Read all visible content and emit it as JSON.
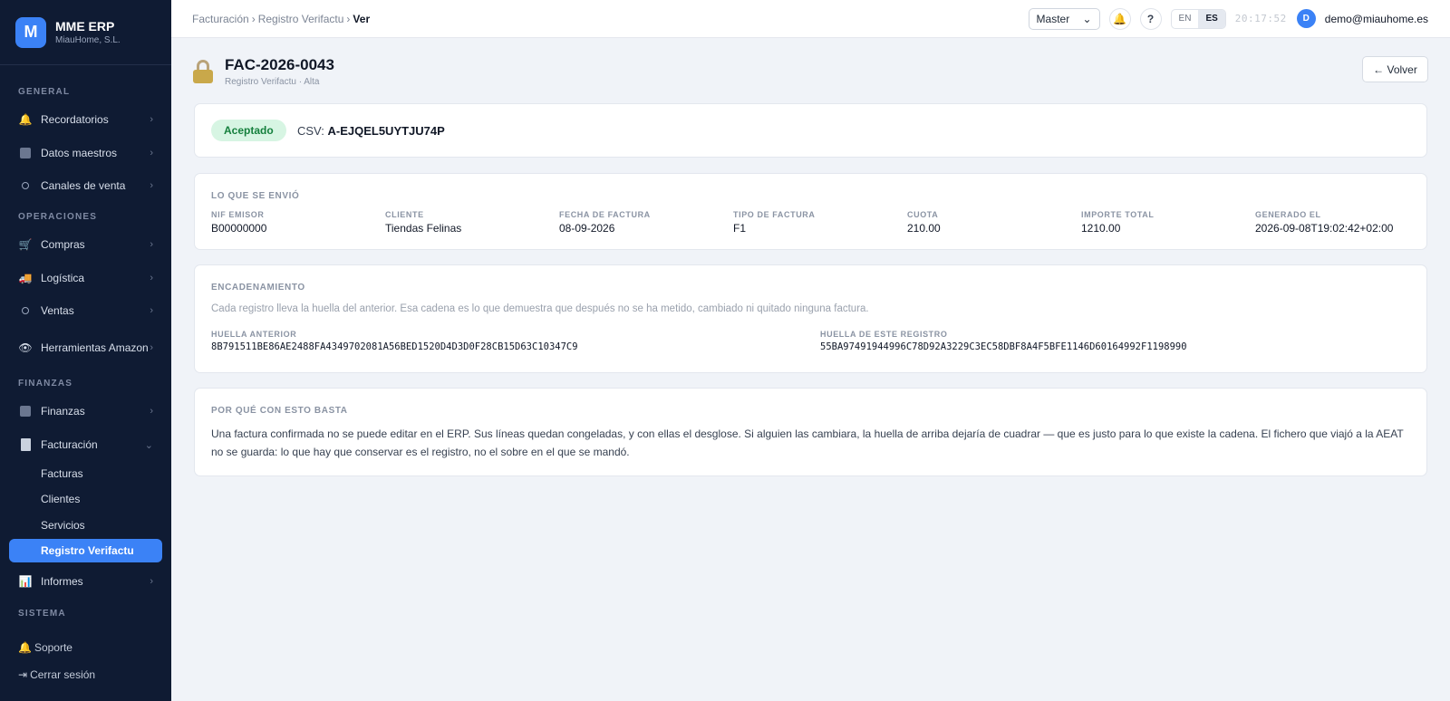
{
  "brand": {
    "logo_letter": "M",
    "name": "MME ERP",
    "company": "MiauHome, S.L."
  },
  "sidebar": {
    "sections": {
      "general": "GENERAL",
      "operaciones": "OPERACIONES",
      "finanzas": "FINANZAS",
      "sistema": "SISTEMA"
    },
    "items": {
      "recordatorios": "Recordatorios",
      "datos_maestros": "Datos maestros",
      "canales_venta": "Canales de venta",
      "compras": "Compras",
      "logistica": "Logística",
      "ventas": "Ventas",
      "herramientas_amazon": "Herramientas Amazon",
      "finanzas": "Finanzas",
      "facturacion": "Facturación",
      "informes": "Informes"
    },
    "subitems": {
      "facturas": "Facturas",
      "clientes": "Clientes",
      "servicios": "Servicios",
      "registro_verifactu": "Registro Verifactu"
    },
    "footer": {
      "soporte": "Soporte",
      "cerrar_sesion": "Cerrar sesión"
    }
  },
  "topbar": {
    "breadcrumb": [
      "Facturación",
      "Registro Verifactu",
      "Ver"
    ],
    "company_select": "Master",
    "help": "?",
    "langs": [
      "EN",
      "ES"
    ],
    "active_lang": "ES",
    "clock": "20:17:52",
    "avatar_letter": "D",
    "user_email": "demo@miauhome.es"
  },
  "header": {
    "title": "FAC-2026-0043",
    "subtitle": "Registro Verifactu · Alta",
    "back_label": "← Volver"
  },
  "status": {
    "badge": "Aceptado",
    "csv_label": "CSV:",
    "csv_value": "A-EJQEL5UYTJU74P"
  },
  "sent": {
    "title": "LO QUE SE ENVIÓ",
    "fields": [
      {
        "label": "NIF EMISOR",
        "value": "B00000000"
      },
      {
        "label": "CLIENTE",
        "value": "Tiendas Felinas"
      },
      {
        "label": "FECHA DE FACTURA",
        "value": "08-09-2026"
      },
      {
        "label": "TIPO DE FACTURA",
        "value": "F1"
      },
      {
        "label": "CUOTA",
        "value": "210.00"
      },
      {
        "label": "IMPORTE TOTAL",
        "value": "1210.00"
      },
      {
        "label": "GENERADO EL",
        "value": "2026-09-08T19:02:42+02:00"
      }
    ]
  },
  "chain": {
    "title": "ENCADENAMIENTO",
    "description": "Cada registro lleva la huella del anterior. Esa cadena es lo que demuestra que después no se ha metido, cambiado ni quitado ninguna factura.",
    "prev_label": "HUELLA ANTERIOR",
    "prev_value": "8B791511BE86AE2488FA4349702081A56BED1520D4D3D0F28CB15D63C10347C9",
    "this_label": "HUELLA DE ESTE REGISTRO",
    "this_value": "55BA97491944996C78D92A3229C3EC58DBF8A4F5BFE1146D60164992F1198990"
  },
  "why": {
    "title": "POR QUÉ CON ESTO BASTA",
    "text": "Una factura confirmada no se puede editar en el ERP. Sus líneas quedan congeladas, y con ellas el desglose. Si alguien las cambiara, la huella de arriba dejaría de cuadrar — que es justo para lo que existe la cadena. El fichero que viajó a la AEAT no se guarda: lo que hay que conservar es el registro, no el sobre en el que se mandó."
  },
  "colors": {
    "sidebar_bg": "#0f1b33",
    "accent": "#3b82f6",
    "success_bg": "#d7f5e3",
    "success_text": "#15803d"
  }
}
